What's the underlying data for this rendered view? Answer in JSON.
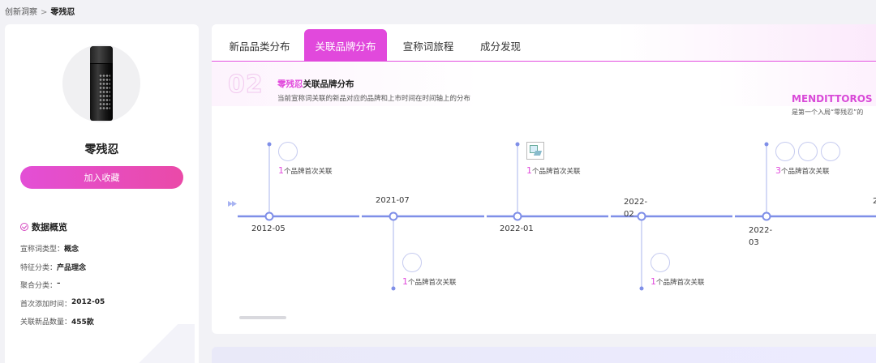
{
  "breadcrumb": {
    "root": "创新洞察",
    "sep": ">",
    "current": "零残忍"
  },
  "sidebar": {
    "product_name": "零残忍",
    "fav_button": "加入收藏",
    "overview_title": "数据概览",
    "stats": [
      {
        "label": "宣称词类型：",
        "value": "概念"
      },
      {
        "label": "特征分类：",
        "value": "产品理念"
      },
      {
        "label": "聚合分类：",
        "value": "–"
      },
      {
        "label": "首次添加时间：",
        "value": "2012-05"
      },
      {
        "label": "关联新品数量：",
        "value": "455款"
      }
    ]
  },
  "tabs": [
    "新品品类分布",
    "关联品牌分布",
    "宣称词旅程",
    "成分发现"
  ],
  "section": {
    "number": "02",
    "title_highlight": "零残忍",
    "title_rest": "关联品牌分布",
    "subtitle": "当前宣称词关联的新品对应的品牌和上市时间在时间轴上的分布",
    "brand_name": "MENDITTOROS",
    "brand_desc": "是第一个入局“零残忍”的"
  },
  "timeline": {
    "events": [
      {
        "date": "2012-05",
        "count": "1",
        "suffix": "个品牌首次关联",
        "logos": 1,
        "side": "up"
      },
      {
        "date": "2021-07",
        "count": "1",
        "suffix": "个品牌首次关联",
        "logos": 1,
        "side": "down"
      },
      {
        "date": "2022-01",
        "count": "1",
        "suffix": "个品牌首次关联",
        "logos": 1,
        "side": "up",
        "broken": true
      },
      {
        "date": "2022-02",
        "count": "1",
        "suffix": "个品牌首次关联",
        "logos": 1,
        "side": "down"
      },
      {
        "date": "2022-03",
        "count": "3",
        "suffix": "个品牌首次关联",
        "logos": 3,
        "side": "up"
      }
    ],
    "next_date_partial": "2"
  },
  "colors": {
    "accent": "#e149dc",
    "axis": "#7f8fe8"
  }
}
